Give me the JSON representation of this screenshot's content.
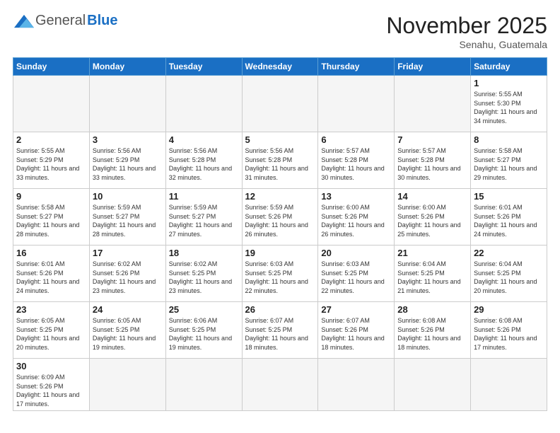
{
  "header": {
    "logo_general": "General",
    "logo_blue": "Blue",
    "month_title": "November 2025",
    "location": "Senahu, Guatemala"
  },
  "weekdays": [
    "Sunday",
    "Monday",
    "Tuesday",
    "Wednesday",
    "Thursday",
    "Friday",
    "Saturday"
  ],
  "weeks": [
    [
      {
        "day": "",
        "empty": true
      },
      {
        "day": "",
        "empty": true
      },
      {
        "day": "",
        "empty": true
      },
      {
        "day": "",
        "empty": true
      },
      {
        "day": "",
        "empty": true
      },
      {
        "day": "",
        "empty": true
      },
      {
        "day": "1",
        "sunrise": "5:55 AM",
        "sunset": "5:30 PM",
        "daylight": "11 hours and 34 minutes."
      }
    ],
    [
      {
        "day": "2",
        "sunrise": "5:55 AM",
        "sunset": "5:29 PM",
        "daylight": "11 hours and 33 minutes."
      },
      {
        "day": "3",
        "sunrise": "5:56 AM",
        "sunset": "5:29 PM",
        "daylight": "11 hours and 33 minutes."
      },
      {
        "day": "4",
        "sunrise": "5:56 AM",
        "sunset": "5:28 PM",
        "daylight": "11 hours and 32 minutes."
      },
      {
        "day": "5",
        "sunrise": "5:56 AM",
        "sunset": "5:28 PM",
        "daylight": "11 hours and 31 minutes."
      },
      {
        "day": "6",
        "sunrise": "5:57 AM",
        "sunset": "5:28 PM",
        "daylight": "11 hours and 30 minutes."
      },
      {
        "day": "7",
        "sunrise": "5:57 AM",
        "sunset": "5:28 PM",
        "daylight": "11 hours and 30 minutes."
      },
      {
        "day": "8",
        "sunrise": "5:58 AM",
        "sunset": "5:27 PM",
        "daylight": "11 hours and 29 minutes."
      }
    ],
    [
      {
        "day": "9",
        "sunrise": "5:58 AM",
        "sunset": "5:27 PM",
        "daylight": "11 hours and 28 minutes."
      },
      {
        "day": "10",
        "sunrise": "5:59 AM",
        "sunset": "5:27 PM",
        "daylight": "11 hours and 28 minutes."
      },
      {
        "day": "11",
        "sunrise": "5:59 AM",
        "sunset": "5:27 PM",
        "daylight": "11 hours and 27 minutes."
      },
      {
        "day": "12",
        "sunrise": "5:59 AM",
        "sunset": "5:26 PM",
        "daylight": "11 hours and 26 minutes."
      },
      {
        "day": "13",
        "sunrise": "6:00 AM",
        "sunset": "5:26 PM",
        "daylight": "11 hours and 26 minutes."
      },
      {
        "day": "14",
        "sunrise": "6:00 AM",
        "sunset": "5:26 PM",
        "daylight": "11 hours and 25 minutes."
      },
      {
        "day": "15",
        "sunrise": "6:01 AM",
        "sunset": "5:26 PM",
        "daylight": "11 hours and 24 minutes."
      }
    ],
    [
      {
        "day": "16",
        "sunrise": "6:01 AM",
        "sunset": "5:26 PM",
        "daylight": "11 hours and 24 minutes."
      },
      {
        "day": "17",
        "sunrise": "6:02 AM",
        "sunset": "5:26 PM",
        "daylight": "11 hours and 23 minutes."
      },
      {
        "day": "18",
        "sunrise": "6:02 AM",
        "sunset": "5:25 PM",
        "daylight": "11 hours and 23 minutes."
      },
      {
        "day": "19",
        "sunrise": "6:03 AM",
        "sunset": "5:25 PM",
        "daylight": "11 hours and 22 minutes."
      },
      {
        "day": "20",
        "sunrise": "6:03 AM",
        "sunset": "5:25 PM",
        "daylight": "11 hours and 22 minutes."
      },
      {
        "day": "21",
        "sunrise": "6:04 AM",
        "sunset": "5:25 PM",
        "daylight": "11 hours and 21 minutes."
      },
      {
        "day": "22",
        "sunrise": "6:04 AM",
        "sunset": "5:25 PM",
        "daylight": "11 hours and 20 minutes."
      }
    ],
    [
      {
        "day": "23",
        "sunrise": "6:05 AM",
        "sunset": "5:25 PM",
        "daylight": "11 hours and 20 minutes."
      },
      {
        "day": "24",
        "sunrise": "6:05 AM",
        "sunset": "5:25 PM",
        "daylight": "11 hours and 19 minutes."
      },
      {
        "day": "25",
        "sunrise": "6:06 AM",
        "sunset": "5:25 PM",
        "daylight": "11 hours and 19 minutes."
      },
      {
        "day": "26",
        "sunrise": "6:07 AM",
        "sunset": "5:25 PM",
        "daylight": "11 hours and 18 minutes."
      },
      {
        "day": "27",
        "sunrise": "6:07 AM",
        "sunset": "5:26 PM",
        "daylight": "11 hours and 18 minutes."
      },
      {
        "day": "28",
        "sunrise": "6:08 AM",
        "sunset": "5:26 PM",
        "daylight": "11 hours and 18 minutes."
      },
      {
        "day": "29",
        "sunrise": "6:08 AM",
        "sunset": "5:26 PM",
        "daylight": "11 hours and 17 minutes."
      }
    ],
    [
      {
        "day": "30",
        "sunrise": "6:09 AM",
        "sunset": "5:26 PM",
        "daylight": "11 hours and 17 minutes."
      },
      {
        "day": "",
        "empty": true
      },
      {
        "day": "",
        "empty": true
      },
      {
        "day": "",
        "empty": true
      },
      {
        "day": "",
        "empty": true
      },
      {
        "day": "",
        "empty": true
      },
      {
        "day": "",
        "empty": true
      }
    ]
  ]
}
